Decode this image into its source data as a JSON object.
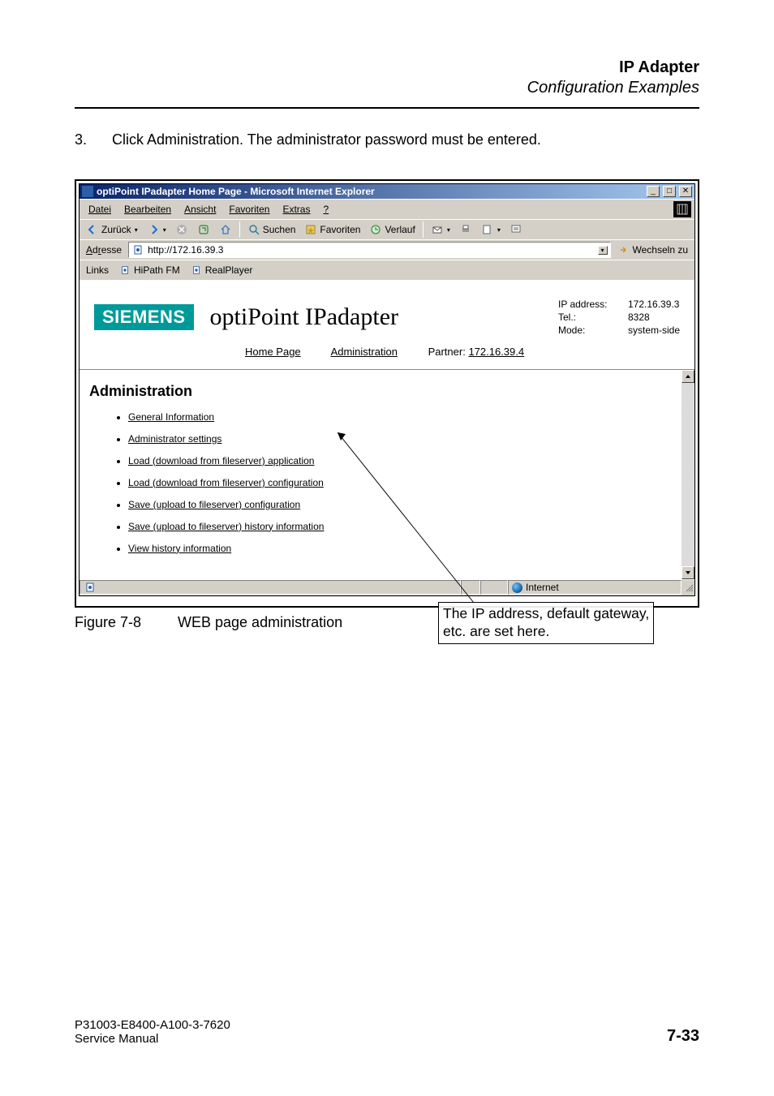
{
  "header": {
    "title": "IP Adapter",
    "subtitle": "Configuration Examples"
  },
  "step": {
    "number": "3.",
    "text": "Click Administration. The administrator password must be entered."
  },
  "browser": {
    "title": "optiPoint IPadapter Home Page - Microsoft Internet Explorer",
    "menu": {
      "items": [
        "Datei",
        "Bearbeiten",
        "Ansicht",
        "Favoriten",
        "Extras",
        "?"
      ],
      "underline_pos": [
        0,
        0,
        0,
        0,
        0,
        0
      ]
    },
    "toolbar": {
      "back": "Zurück",
      "search": "Suchen",
      "favorites": "Favoriten",
      "history": "Verlauf"
    },
    "address": {
      "label": "Adresse",
      "value": "http://172.16.39.3",
      "go": "Wechseln zu"
    },
    "links": {
      "label": "Links",
      "items": [
        "HiPath FM",
        "RealPlayer"
      ]
    },
    "page": {
      "brand": "SIEMENS",
      "product": "optiPoint IPadapter",
      "info": {
        "ip_label": "IP address:",
        "ip": "172.16.39.3",
        "tel_label": "Tel.:",
        "tel": "8328",
        "mode_label": "Mode:",
        "mode": "system-side"
      },
      "nav": {
        "home": "Home Page",
        "admin": "Administration",
        "partner_label": "Partner:",
        "partner_value": "172.16.39.4"
      },
      "section_title": "Administration",
      "links": [
        "General Information",
        "Administrator settings",
        "Load (download from fileserver) application",
        "Load (download from fileserver) configuration",
        "Save (upload to fileserver) configuration",
        "Save (upload to fileserver) history information",
        "View history information"
      ]
    },
    "status": {
      "zone": "Internet"
    }
  },
  "callout": {
    "line1": "The IP address, default gateway,",
    "line2": "etc. are set here."
  },
  "figure": {
    "label": "Figure 7-8",
    "caption": "WEB page administration"
  },
  "footer": {
    "docnum": "P31003-E8400-A100-3-7620",
    "manual": "Service Manual",
    "page": "7-33"
  }
}
